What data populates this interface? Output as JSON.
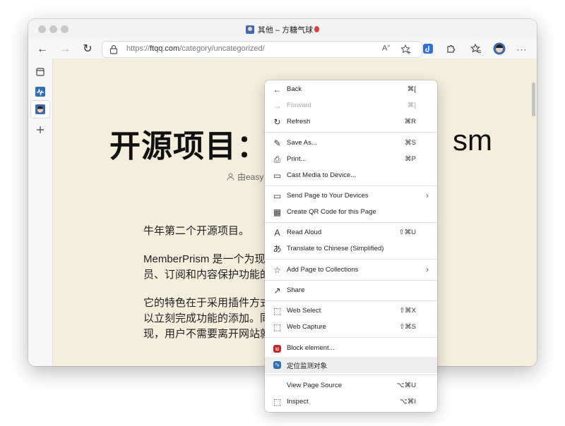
{
  "window": {
    "tab_title": "其他 – 方糖气球",
    "url_prefix": "https://",
    "url_host": "ftqq.com",
    "url_path": "/category/uncategorized/"
  },
  "toolbar": {
    "read_aloud_glyph": "A",
    "read_aloud_sup": "»",
    "more_glyph": "···",
    "back_glyph": "←",
    "forward_glyph": "→",
    "refresh_glyph": "↻"
  },
  "page": {
    "title_left": "开源项目：",
    "title_right": "sm",
    "author_prefix": "由easy",
    "para1": "牛年第二个开源项目。",
    "para2_line1": "MemberPrism 是一个为现",
    "para2_line2": "员、订阅和内容保护功能的",
    "para3_line1": "它的特色在于采用插件方式",
    "para3_line2": "以立刻完成功能的添加。同",
    "para3_line3": "现，用户不需要离开网站就"
  },
  "context_menu": {
    "items": [
      {
        "icon": "←",
        "label": "Back",
        "shortcut": "⌘["
      },
      {
        "icon": "→",
        "label": "Forward",
        "shortcut": "⌘]"
      },
      {
        "icon": "↻",
        "label": "Refresh",
        "shortcut": "⌘R"
      },
      {
        "icon": "✎",
        "label": "Save As...",
        "shortcut": "⌘S"
      },
      {
        "icon": "⎙",
        "label": "Print...",
        "shortcut": "⌘P"
      },
      {
        "icon": "▭",
        "label": "Cast Media to Device...",
        "shortcut": ""
      },
      {
        "icon": "▭",
        "label": "Send Page to Your Devices",
        "shortcut": "›"
      },
      {
        "icon": "▦",
        "label": "Create QR Code for this Page",
        "shortcut": ""
      },
      {
        "icon": "A",
        "label": "Read Aloud",
        "shortcut": "⇧⌘U"
      },
      {
        "icon": "あ",
        "label": "Translate to Chinese (Simplified)",
        "shortcut": ""
      },
      {
        "icon": "☆",
        "label": "Add Page to Collections",
        "shortcut": "›"
      },
      {
        "icon": "↗",
        "label": "Share",
        "shortcut": ""
      },
      {
        "icon": "⬚",
        "label": "Web Select",
        "shortcut": "⇧⌘X"
      },
      {
        "icon": "⬚",
        "label": "Web Capture",
        "shortcut": "⇧⌘S"
      },
      {
        "icon": "u",
        "label": "Block element...",
        "shortcut": ""
      },
      {
        "icon": "∿",
        "label": "定位监测对象",
        "shortcut": ""
      },
      {
        "icon": "",
        "label": "View Page Source",
        "shortcut": "⌥⌘U"
      },
      {
        "icon": "⬚",
        "label": "Inspect",
        "shortcut": "⌥⌘I"
      }
    ]
  },
  "colors": {
    "page_bg": "#f4eedd",
    "menu_highlight": "#eeeeee",
    "block_icon": "#c62828",
    "monitor_icon": "#2f6fb3"
  }
}
